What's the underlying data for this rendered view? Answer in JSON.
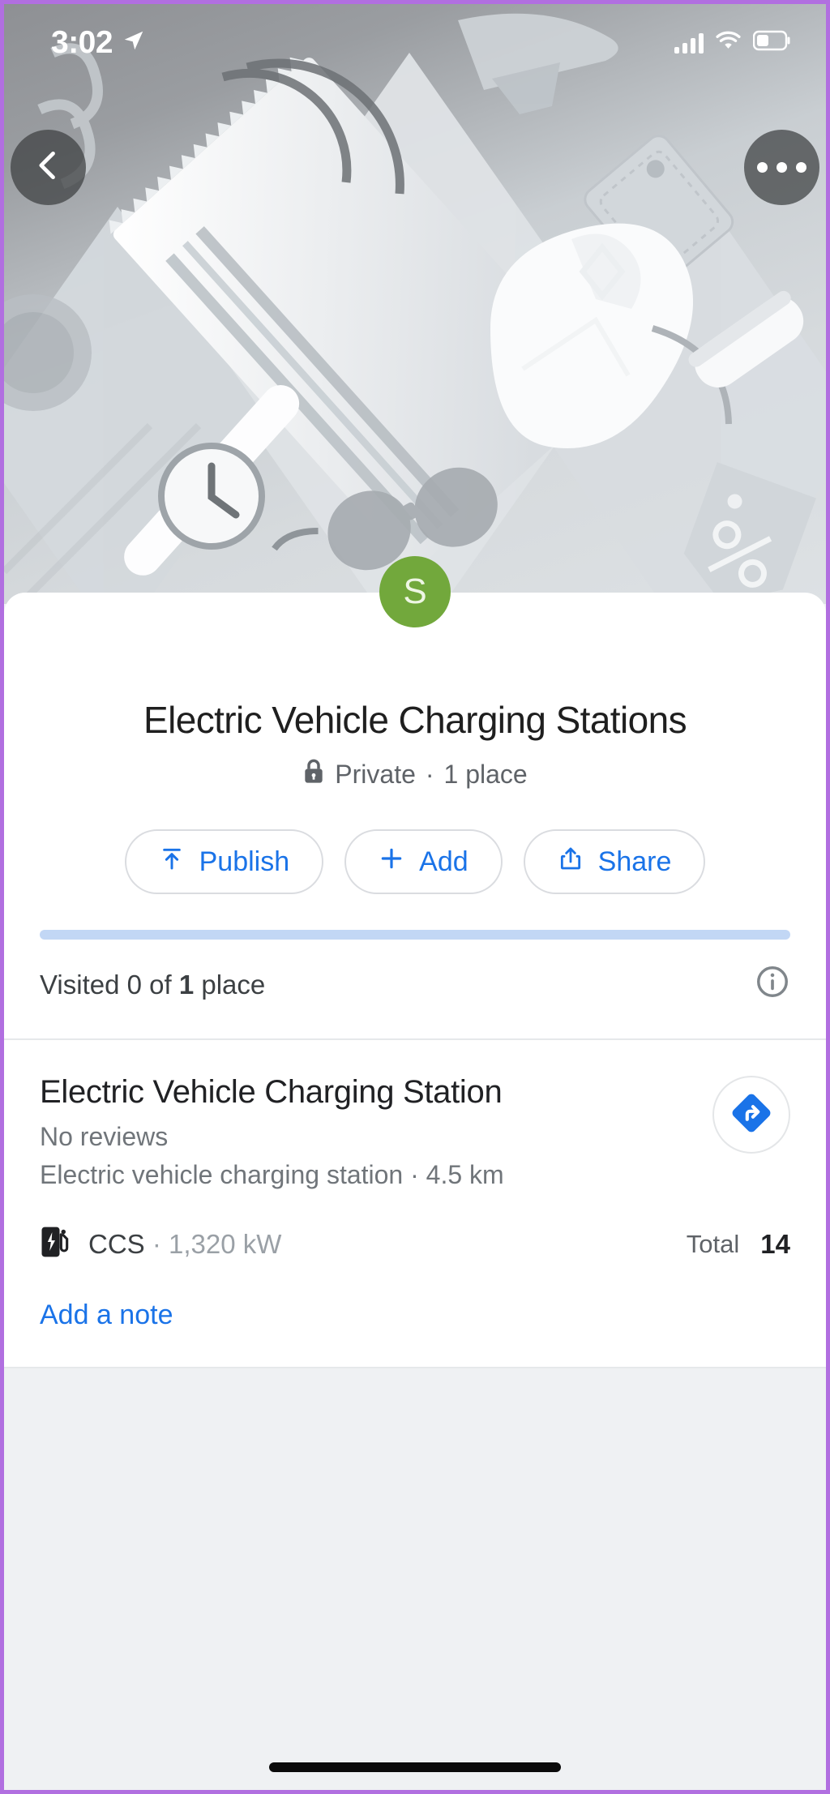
{
  "status_bar": {
    "time": "3:02",
    "location_icon": "location-arrow-icon",
    "signal_icon": "cellular-bars-icon",
    "wifi_icon": "wifi-icon",
    "battery_icon": "battery-icon",
    "battery_level_percent": 40
  },
  "header": {
    "back_icon": "chevron-left-icon",
    "more_icon": "more-horizontal-icon",
    "banner_illustration": "travel-shopping-isometric-illustration"
  },
  "list": {
    "avatar_letter": "S",
    "avatar_color": "#72a83c",
    "title": "Electric Vehicle Charging Stations",
    "privacy_icon": "lock-icon",
    "privacy": "Private",
    "separator": "·",
    "place_count": "1 place",
    "actions": [
      {
        "label": "Publish",
        "icon": "publish-upload-icon"
      },
      {
        "label": "Add",
        "icon": "plus-icon"
      },
      {
        "label": "Share",
        "icon": "share-icon"
      }
    ],
    "progress": {
      "percent": 0,
      "track_color": "#c2d7f5",
      "fill_color": "#1a73e8"
    },
    "visited_prefix": "Visited 0 of ",
    "visited_bold": "1",
    "visited_suffix": " place",
    "info_icon": "info-circle-icon"
  },
  "place": {
    "name": "Electric Vehicle Charging Station",
    "reviews": "No reviews",
    "category_distance": "Electric vehicle charging station · 4.5 km",
    "directions_icon": "directions-arrow-icon",
    "directions_color": "#1a73e8",
    "charger": {
      "icon": "ev-charger-icon",
      "type": "CCS",
      "separator": "·",
      "power": "1,320 kW",
      "total_label": "Total",
      "total_value": "14"
    },
    "add_note_label": "Add a note",
    "link_color": "#1a73e8"
  },
  "footer": {
    "home_indicator": "home-indicator-bar"
  }
}
